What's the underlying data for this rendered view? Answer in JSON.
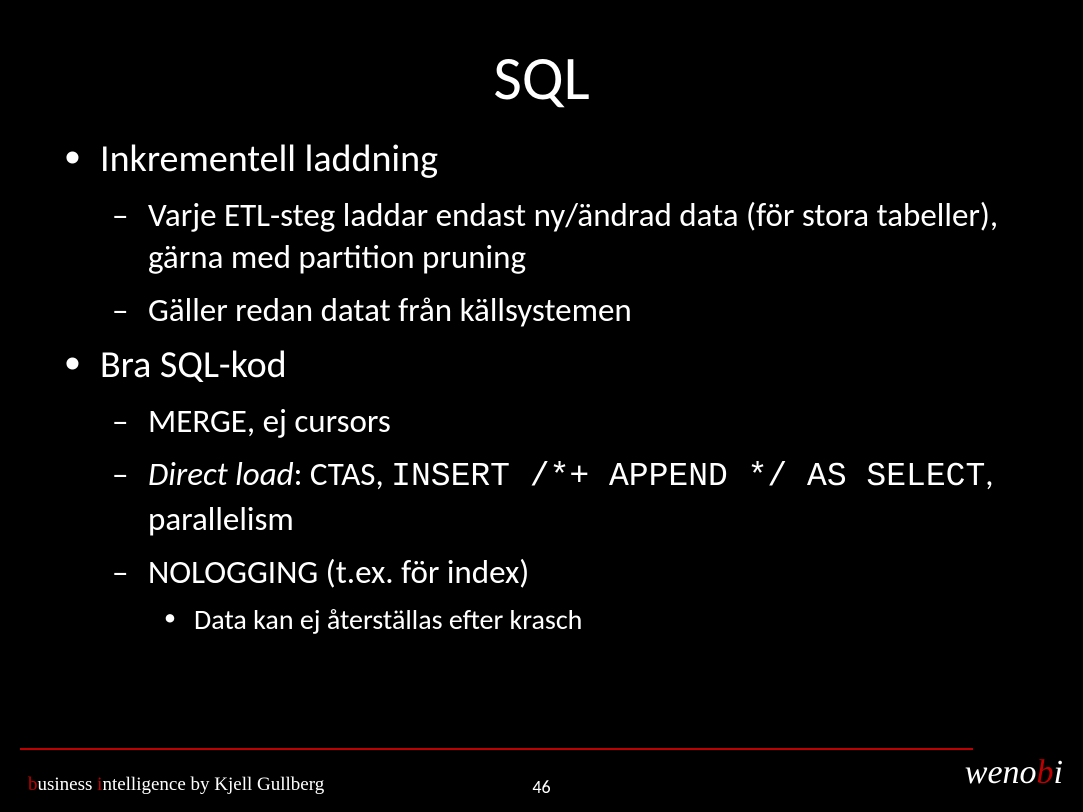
{
  "title": "SQL",
  "bullets": [
    {
      "text": "Inkrementell laddning",
      "children": [
        {
          "text": "Varje ETL-steg laddar endast ny/ändrad data (för stora tabeller), gärna med partition pruning"
        },
        {
          "text": "Gäller redan datat från källsystemen"
        }
      ]
    },
    {
      "text": "Bra SQL-kod",
      "children": [
        {
          "text": "MERGE, ej cursors"
        },
        {
          "direct_load_italic": "Direct load",
          "direct_load_mid": ": CTAS, ",
          "direct_load_code": "INSERT /*+ APPEND */ AS SELECT",
          "direct_load_tail": ", parallelism"
        },
        {
          "text": "NOLOGGING (t.ex. för index)",
          "children": [
            {
              "text": "Data kan ej återställas efter krasch"
            }
          ]
        }
      ]
    }
  ],
  "footer": {
    "tag_b": "b",
    "tag_usiness": "usiness ",
    "tag_i": "i",
    "tag_rest": "ntelligence by Kjell Gullberg",
    "page": "46",
    "logo_pre": "weno",
    "logo_b": "b",
    "logo_i": "i"
  }
}
